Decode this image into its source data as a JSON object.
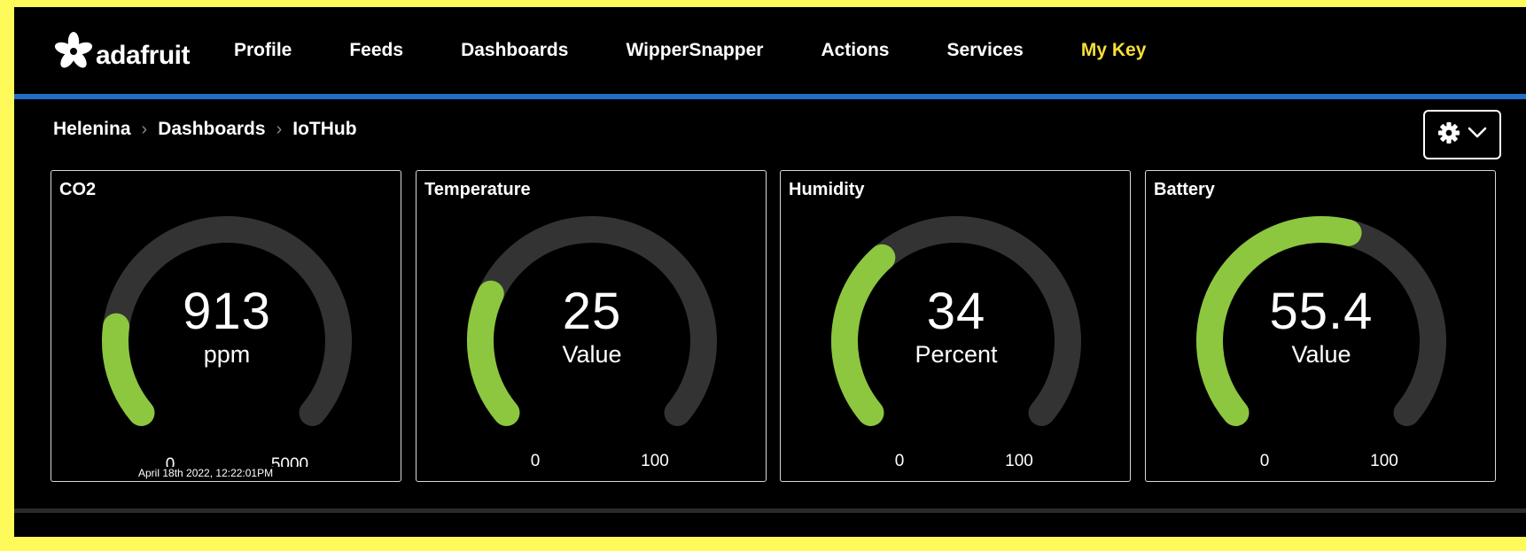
{
  "brand": {
    "name": "adafruit",
    "logo_icon": "adafruit-flower-icon"
  },
  "nav": {
    "items": [
      {
        "label": "Profile"
      },
      {
        "label": "Feeds"
      },
      {
        "label": "Dashboards"
      },
      {
        "label": "WipperSnapper"
      },
      {
        "label": "Actions"
      },
      {
        "label": "Services"
      },
      {
        "label": "My Key",
        "active": true
      }
    ]
  },
  "breadcrumb": {
    "items": [
      "Helenina",
      "Dashboards",
      "IoTHub"
    ],
    "separator": ">"
  },
  "settings": {
    "icons": [
      "gear-icon",
      "chevron-down-icon"
    ]
  },
  "colors": {
    "accent_yellow": "#f7df3a",
    "nav_bar_blue": "#1f6fc8",
    "gauge_fill": "#8dc63f",
    "gauge_track": "#333333",
    "background": "#000000"
  },
  "gauges": [
    {
      "title": "CO2",
      "value": "913",
      "unit": "ppm",
      "min": "0",
      "max": "5000",
      "level": 0.1826,
      "timestamp": "April 18th 2022, 12:22:01PM"
    },
    {
      "title": "Temperature",
      "value": "25",
      "unit": "Value",
      "min": "0",
      "max": "100",
      "level": 0.25
    },
    {
      "title": "Humidity",
      "value": "34",
      "unit": "Percent",
      "min": "0",
      "max": "100",
      "level": 0.34
    },
    {
      "title": "Battery",
      "value": "55.4",
      "unit": "Value",
      "min": "0",
      "max": "100",
      "level": 0.554
    }
  ]
}
